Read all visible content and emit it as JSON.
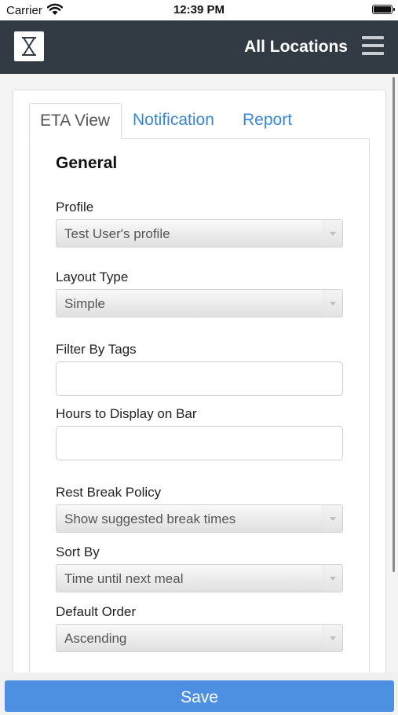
{
  "status_bar": {
    "carrier": "Carrier",
    "time": "12:39 PM",
    "wifi_icon": "wifi-icon",
    "battery_icon": "battery-icon"
  },
  "header": {
    "title": "All Locations",
    "logo_icon": "hourglass-logo-icon",
    "menu_icon": "hamburger-menu-icon",
    "background": "#323b44"
  },
  "tabs": [
    {
      "label": "ETA View",
      "active": true
    },
    {
      "label": "Notification",
      "active": false
    },
    {
      "label": "Report",
      "active": false
    }
  ],
  "form": {
    "section_title": "General",
    "profile": {
      "label": "Profile",
      "value": "Test User's profile"
    },
    "layout_type": {
      "label": "Layout Type",
      "value": "Simple"
    },
    "filter_by_tags": {
      "label": "Filter By Tags",
      "value": ""
    },
    "hours_to_display": {
      "label": "Hours to Display on Bar",
      "value": ""
    },
    "rest_break_policy": {
      "label": "Rest Break Policy",
      "value": "Show suggested break times"
    },
    "sort_by": {
      "label": "Sort By",
      "value": "Time until next meal"
    },
    "default_order": {
      "label": "Default Order",
      "value": "Ascending"
    }
  },
  "footer": {
    "save_label": "Save",
    "save_color": "#4d8fe0"
  },
  "colors": {
    "tab_link": "#3a86d0",
    "page_bg": "#f4f4f4"
  }
}
